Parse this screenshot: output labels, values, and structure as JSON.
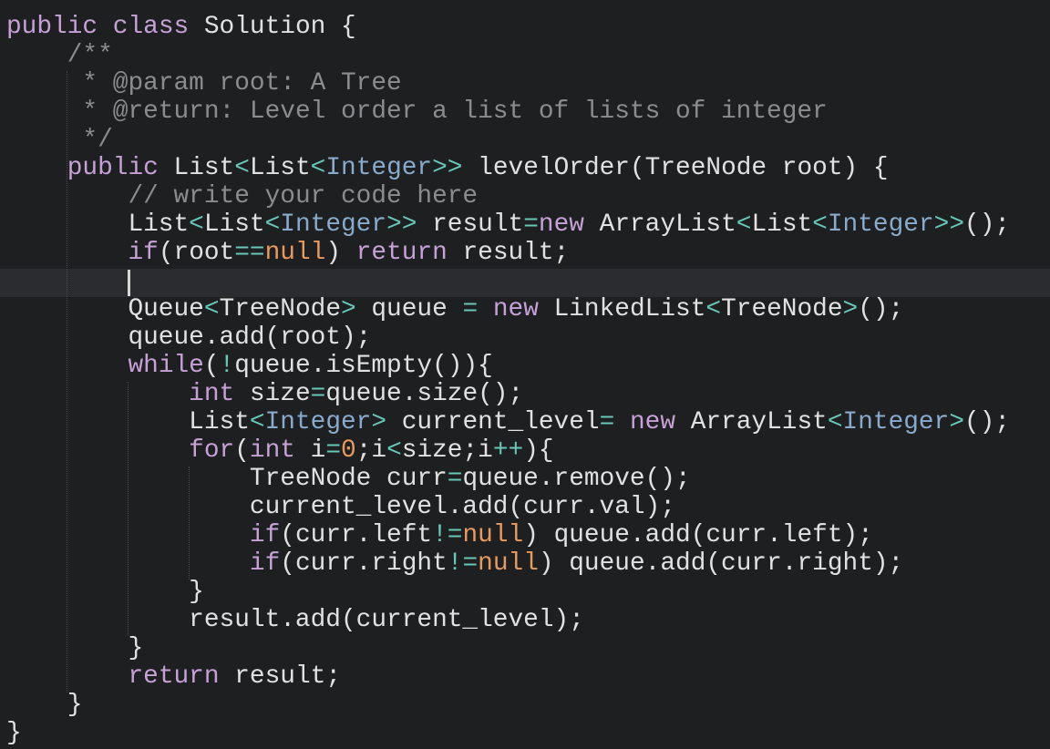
{
  "editor": {
    "language": "java",
    "cursor_line": 10,
    "colors": {
      "background": "#1e1f21",
      "current_line": "#2b2c2f",
      "keyword": "#c6a0d6",
      "generic_type": "#88aacc",
      "operator": "#66c9b8",
      "literal": "#e89a5e",
      "comment": "#8b8c8e",
      "text": "#e1e1e1"
    },
    "lines": [
      [
        {
          "t": "public",
          "c": "kw"
        },
        {
          "t": " "
        },
        {
          "t": "class",
          "c": "kw"
        },
        {
          "t": " Solution {"
        }
      ],
      [
        {
          "t": "    "
        },
        {
          "t": "/**",
          "c": "cm"
        }
      ],
      [
        {
          "t": "     "
        },
        {
          "t": "* @param root: A Tree",
          "c": "cm"
        }
      ],
      [
        {
          "t": "     "
        },
        {
          "t": "* @return: Level order a list of lists of integer",
          "c": "cm"
        }
      ],
      [
        {
          "t": "     "
        },
        {
          "t": "*/",
          "c": "cm"
        }
      ],
      [
        {
          "t": "    "
        },
        {
          "t": "public",
          "c": "kw"
        },
        {
          "t": " List"
        },
        {
          "t": "<",
          "c": "op"
        },
        {
          "t": "List"
        },
        {
          "t": "<",
          "c": "op"
        },
        {
          "t": "Integer",
          "c": "gen"
        },
        {
          "t": ">>",
          "c": "op"
        },
        {
          "t": " levelOrder(TreeNode root) {"
        }
      ],
      [
        {
          "t": "        "
        },
        {
          "t": "// write your code here",
          "c": "cm"
        }
      ],
      [
        {
          "t": "        List"
        },
        {
          "t": "<",
          "c": "op"
        },
        {
          "t": "List"
        },
        {
          "t": "<",
          "c": "op"
        },
        {
          "t": "Integer",
          "c": "gen"
        },
        {
          "t": ">>",
          "c": "op"
        },
        {
          "t": " result"
        },
        {
          "t": "=",
          "c": "op"
        },
        {
          "t": "new",
          "c": "kw"
        },
        {
          "t": " ArrayList"
        },
        {
          "t": "<",
          "c": "op"
        },
        {
          "t": "List"
        },
        {
          "t": "<",
          "c": "op"
        },
        {
          "t": "Integer",
          "c": "gen"
        },
        {
          "t": ">>",
          "c": "op"
        },
        {
          "t": "();"
        }
      ],
      [
        {
          "t": "        "
        },
        {
          "t": "if",
          "c": "kw"
        },
        {
          "t": "(root"
        },
        {
          "t": "==",
          "c": "op"
        },
        {
          "t": "null",
          "c": "num"
        },
        {
          "t": ") "
        },
        {
          "t": "return",
          "c": "kw"
        },
        {
          "t": " result;"
        }
      ],
      [
        {
          "t": ""
        }
      ],
      [
        {
          "t": "        Queue"
        },
        {
          "t": "<",
          "c": "op"
        },
        {
          "t": "TreeNode"
        },
        {
          "t": ">",
          "c": "op"
        },
        {
          "t": " queue "
        },
        {
          "t": "=",
          "c": "op"
        },
        {
          "t": " "
        },
        {
          "t": "new",
          "c": "kw"
        },
        {
          "t": " LinkedList"
        },
        {
          "t": "<",
          "c": "op"
        },
        {
          "t": "TreeNode"
        },
        {
          "t": ">",
          "c": "op"
        },
        {
          "t": "();"
        }
      ],
      [
        {
          "t": "        queue.add(root);"
        }
      ],
      [
        {
          "t": "        "
        },
        {
          "t": "while",
          "c": "kw"
        },
        {
          "t": "("
        },
        {
          "t": "!",
          "c": "op"
        },
        {
          "t": "queue.isEmpty()){"
        }
      ],
      [
        {
          "t": "            "
        },
        {
          "t": "int",
          "c": "kw"
        },
        {
          "t": " size"
        },
        {
          "t": "=",
          "c": "op"
        },
        {
          "t": "queue.size();"
        }
      ],
      [
        {
          "t": "            List"
        },
        {
          "t": "<",
          "c": "op"
        },
        {
          "t": "Integer",
          "c": "gen"
        },
        {
          "t": ">",
          "c": "op"
        },
        {
          "t": " current_level"
        },
        {
          "t": "=",
          "c": "op"
        },
        {
          "t": " "
        },
        {
          "t": "new",
          "c": "kw"
        },
        {
          "t": " ArrayList"
        },
        {
          "t": "<",
          "c": "op"
        },
        {
          "t": "Integer",
          "c": "gen"
        },
        {
          "t": ">",
          "c": "op"
        },
        {
          "t": "();"
        }
      ],
      [
        {
          "t": "            "
        },
        {
          "t": "for",
          "c": "kw"
        },
        {
          "t": "("
        },
        {
          "t": "int",
          "c": "kw"
        },
        {
          "t": " i"
        },
        {
          "t": "=",
          "c": "op"
        },
        {
          "t": "0",
          "c": "num"
        },
        {
          "t": ";i"
        },
        {
          "t": "<",
          "c": "op"
        },
        {
          "t": "size;i"
        },
        {
          "t": "++",
          "c": "op"
        },
        {
          "t": "){"
        }
      ],
      [
        {
          "t": "                TreeNode curr"
        },
        {
          "t": "=",
          "c": "op"
        },
        {
          "t": "queue.remove();"
        }
      ],
      [
        {
          "t": "                current_level.add(curr.val);"
        }
      ],
      [
        {
          "t": "                "
        },
        {
          "t": "if",
          "c": "kw"
        },
        {
          "t": "(curr.left"
        },
        {
          "t": "!=",
          "c": "op"
        },
        {
          "t": "null",
          "c": "num"
        },
        {
          "t": ") queue.add(curr.left);"
        }
      ],
      [
        {
          "t": "                "
        },
        {
          "t": "if",
          "c": "kw"
        },
        {
          "t": "(curr.right"
        },
        {
          "t": "!=",
          "c": "op"
        },
        {
          "t": "null",
          "c": "num"
        },
        {
          "t": ") queue.add(curr.right);"
        }
      ],
      [
        {
          "t": "            }"
        }
      ],
      [
        {
          "t": "            result.add(current_level);"
        }
      ],
      [
        {
          "t": "        }"
        }
      ],
      [
        {
          "t": "        "
        },
        {
          "t": "return",
          "c": "kw"
        },
        {
          "t": " result;"
        }
      ],
      [
        {
          "t": "    }"
        }
      ],
      [
        {
          "t": "}"
        }
      ]
    ]
  }
}
